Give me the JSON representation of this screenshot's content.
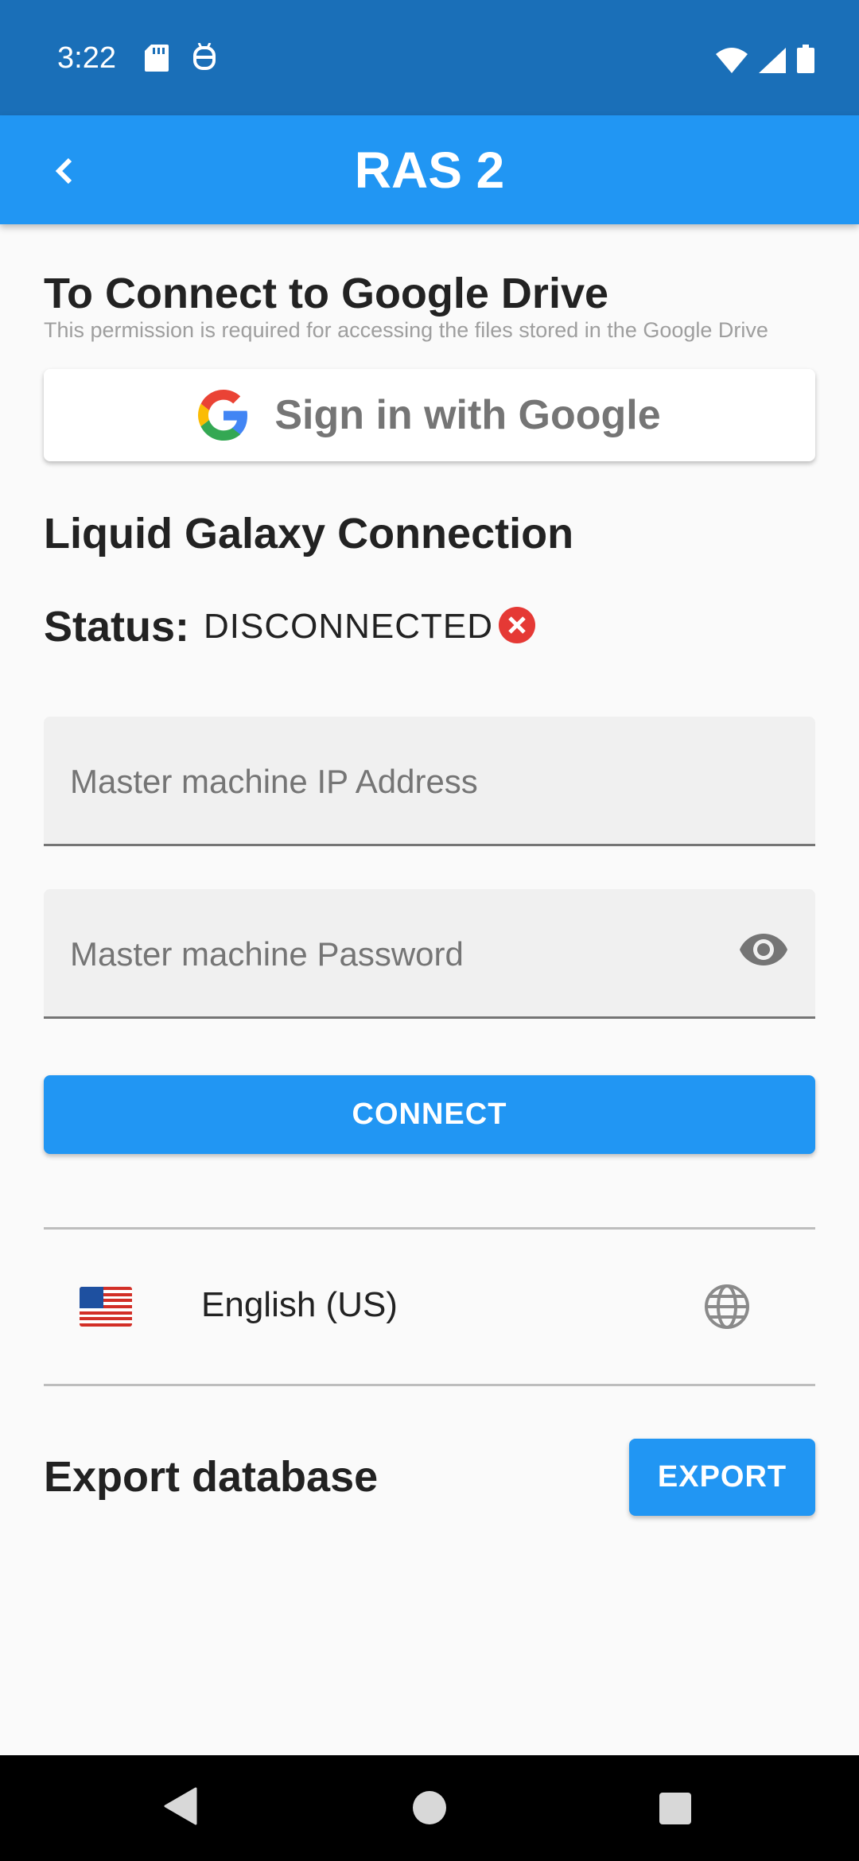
{
  "status_bar": {
    "time": "3:22"
  },
  "app_bar": {
    "title": "RAS 2"
  },
  "google_drive": {
    "title": "To Connect to Google Drive",
    "subtitle": "This permission is required for accessing the files stored in the Google Drive",
    "sign_in_label": "Sign in with Google"
  },
  "liquid_galaxy": {
    "title": "Liquid Galaxy Connection",
    "status_label": "Status:",
    "status_value": "DISCONNECTED",
    "status_color": "#e53935",
    "ip_field": {
      "placeholder": "Master machine IP Address",
      "value": ""
    },
    "password_field": {
      "placeholder": "Master machine Password",
      "value": ""
    },
    "connect_label": "CONNECT"
  },
  "language": {
    "flag": "us-flag",
    "label": "English (US)"
  },
  "export": {
    "title": "Export database",
    "button_label": "EXPORT"
  },
  "colors": {
    "primary": "#2196f3",
    "status_bar": "#1a6fb8"
  }
}
